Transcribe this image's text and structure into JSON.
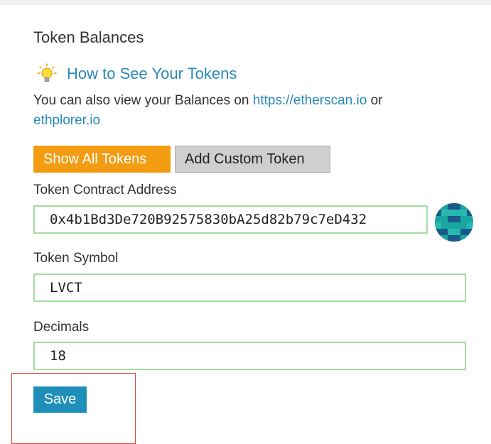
{
  "section": {
    "title": "Token Balances"
  },
  "howto": {
    "icon": "lightbulb-icon",
    "link_text": "How to See Your Tokens"
  },
  "balances": {
    "text_prefix": "You can also view your Balances on ",
    "link_etherscan": "https://etherscan.io",
    "text_middle": " or",
    "link_ethplorer": "ethplorer.io"
  },
  "buttons": {
    "show_all_tokens": "Show All Tokens",
    "add_custom_token": "Add Custom Token",
    "save": "Save"
  },
  "fields": {
    "contract_address": {
      "label": "Token Contract Address",
      "value": "0x4b1Bd3De720B92575830bA25d82b79c7eD432"
    },
    "token_symbol": {
      "label": "Token Symbol",
      "value": "LVCT"
    },
    "decimals": {
      "label": "Decimals",
      "value": "18"
    }
  },
  "colors": {
    "link": "#2a8ab8",
    "orange_button": "#f39c12",
    "gray_button": "#cfcfcf",
    "save_button": "#1f8fba",
    "input_border_valid": "#a4dca0",
    "highlight_box": "#e0473a",
    "identicon_primary": "#1aa6a0",
    "identicon_secondary": "#1a5a8a"
  }
}
